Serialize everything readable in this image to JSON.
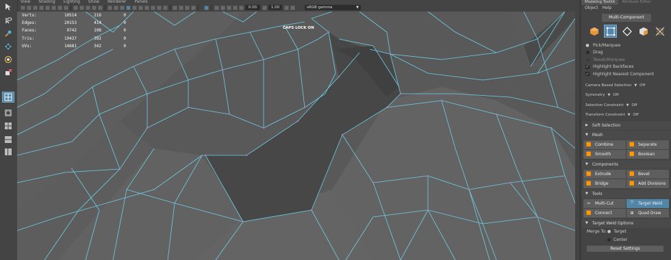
{
  "menubar": {
    "items": [
      "View",
      "Shading",
      "Lighting",
      "Show",
      "Renderer",
      "Panels"
    ]
  },
  "toolbar": {
    "gamma_value": "0.00",
    "exposure_value": "1.00",
    "colorspace": "sRGB gamma"
  },
  "hud": {
    "rows": [
      {
        "label": "Verts:",
        "a": "10514",
        "b": "216",
        "c": "0"
      },
      {
        "label": "Edges:",
        "a": "20153",
        "b": "414",
        "c": "0"
      },
      {
        "label": "Faces:",
        "a": "9742",
        "b": "198",
        "c": "0"
      },
      {
        "label": "Tris:",
        "a": "19437",
        "b": "392",
        "c": "0"
      },
      {
        "label": "UVs:",
        "a": "14681",
        "b": "342",
        "c": "0"
      }
    ],
    "caps_lock": "CAPS LOCK ON"
  },
  "panel": {
    "tab_active": "Modeling Toolkit",
    "tab_inactive": "Attribute Editor",
    "menu": [
      "Object",
      "Help"
    ],
    "mode": "Multi-Component",
    "mode_icons": [
      "object-mode-icon",
      "multi-component-icon",
      "edge-mode-icon",
      "face-mode-icon",
      "uv-mode-icon"
    ],
    "selection_options": [
      {
        "label": "Pick/Marquee",
        "mark": "dot",
        "disabled": false
      },
      {
        "label": "Drag",
        "mark": "none",
        "disabled": false
      },
      {
        "label": "Tweak/Marquee",
        "mark": "none",
        "disabled": true
      },
      {
        "label": "Highlight Backfaces",
        "mark": "check",
        "disabled": false
      },
      {
        "label": "Highlight Nearest Component",
        "mark": "check",
        "disabled": false
      }
    ],
    "settings": [
      {
        "label": "Camera Based Selection",
        "value": "Off"
      },
      {
        "label": "Symmetry",
        "value": "Off"
      },
      {
        "label": "Selection Constraint",
        "value": "Off"
      },
      {
        "label": "Transform Constraint",
        "value": "Off"
      }
    ],
    "soft_selection": "Soft Selection",
    "sections": {
      "mesh": {
        "title": "Mesh",
        "buttons": [
          "Combine",
          "Separate",
          "Smooth",
          "Boolean"
        ]
      },
      "components": {
        "title": "Components",
        "buttons": [
          "Extrude",
          "Bevel",
          "Bridge",
          "Add Divisions"
        ]
      },
      "tools": {
        "title": "Tools",
        "buttons": [
          "Multi-Cut",
          "Target Weld",
          "Connect",
          "Quad Draw"
        ]
      }
    },
    "weld_options": {
      "title": "Target Weld Options",
      "merge_to_label": "Merge To:",
      "merge_options": [
        "Target",
        "Center"
      ],
      "reset": "Reset Settings"
    }
  },
  "colors": {
    "accent": "#5286a8",
    "wire": "#6fd6f0",
    "bg": "#444444"
  }
}
